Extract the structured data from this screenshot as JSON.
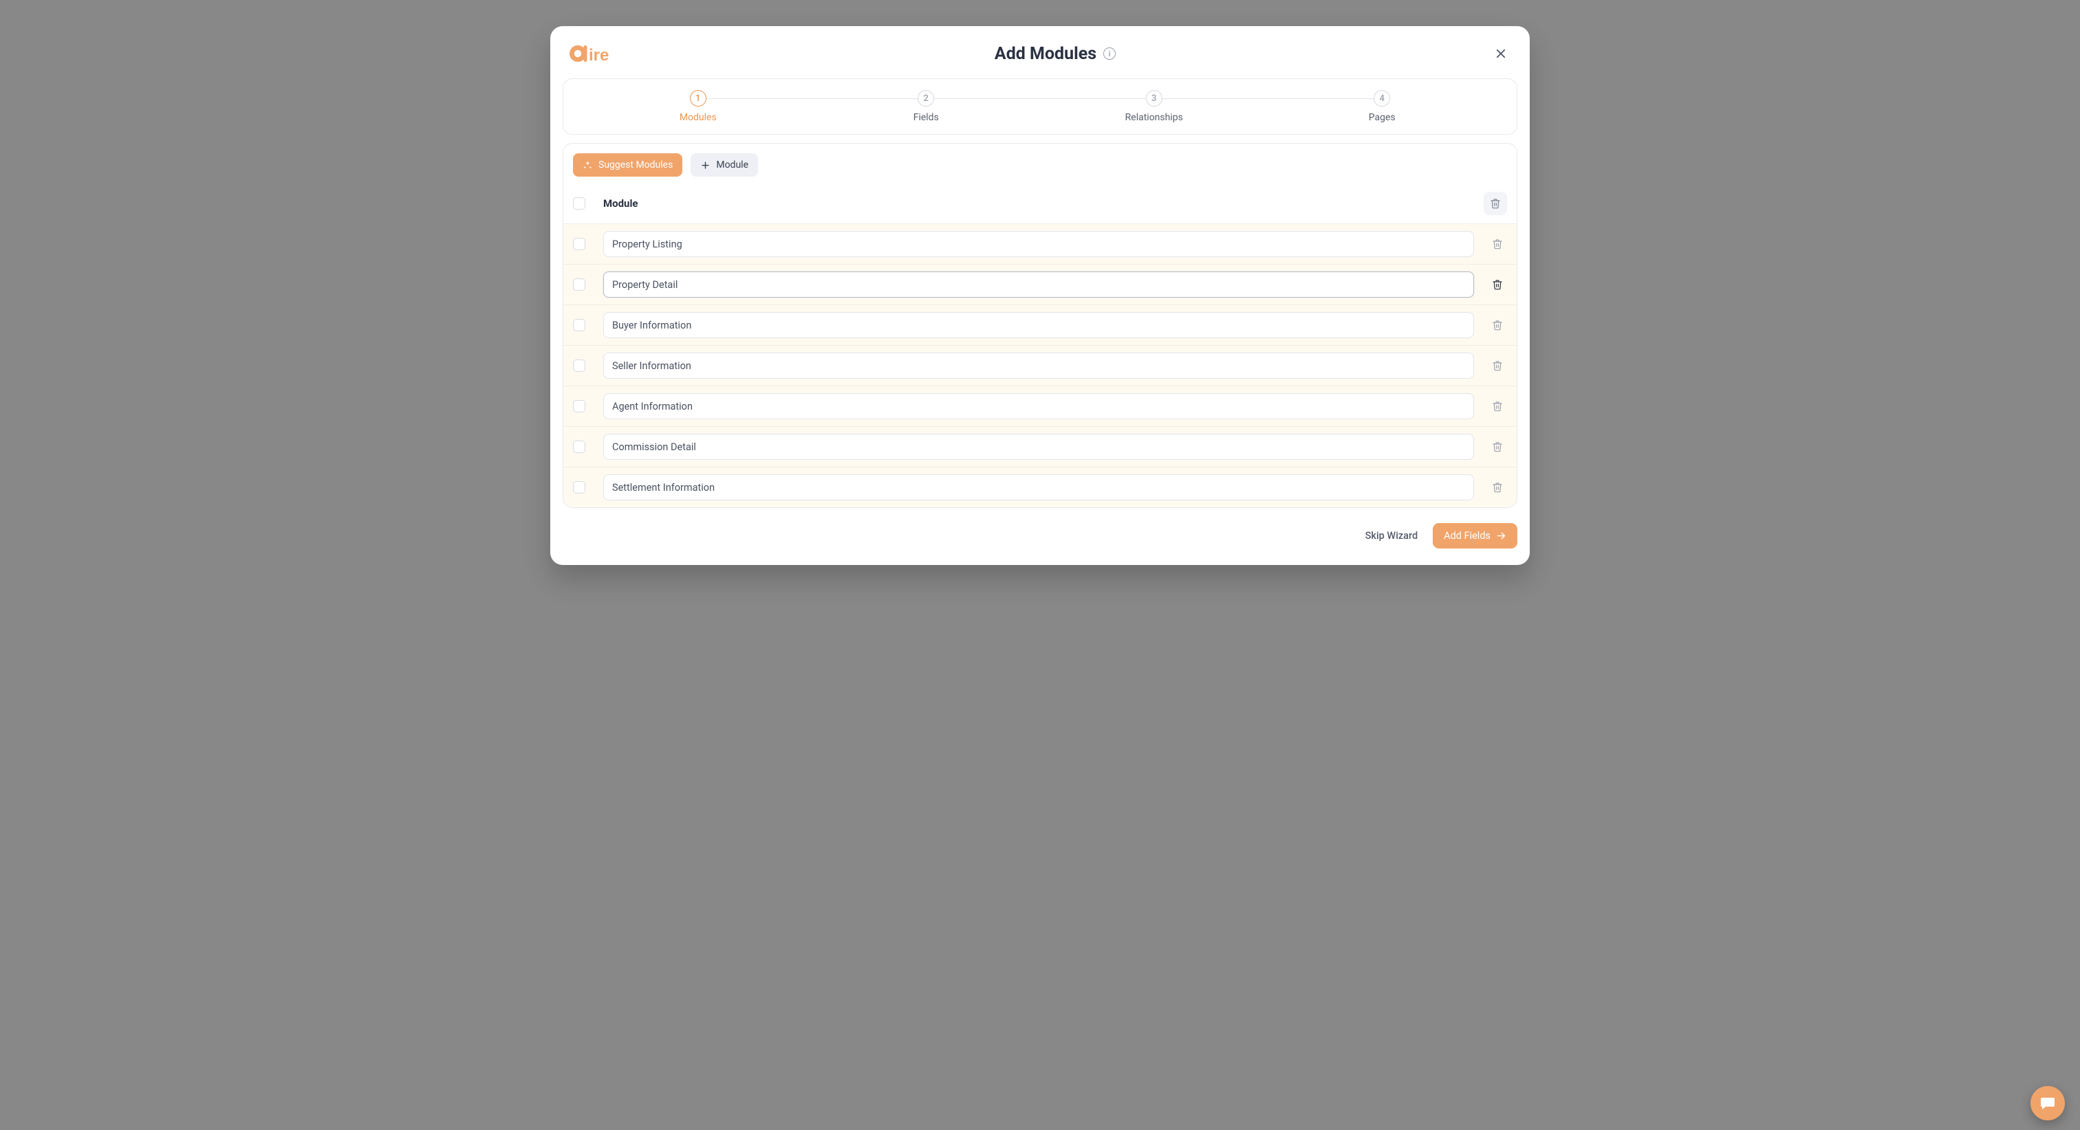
{
  "header": {
    "title": "Add Modules"
  },
  "stepper": {
    "steps": [
      {
        "num": "1",
        "label": "Modules",
        "active": true
      },
      {
        "num": "2",
        "label": "Fields",
        "active": false
      },
      {
        "num": "3",
        "label": "Relationships",
        "active": false
      },
      {
        "num": "4",
        "label": "Pages",
        "active": false
      }
    ]
  },
  "toolbar": {
    "suggest_label": "Suggest Modules",
    "add_module_label": "Module"
  },
  "table": {
    "column_label": "Module",
    "rows": [
      {
        "value": "Property Listing",
        "focused": false
      },
      {
        "value": "Property Detail",
        "focused": true
      },
      {
        "value": "Buyer Information",
        "focused": false
      },
      {
        "value": "Seller Information",
        "focused": false
      },
      {
        "value": "Agent Information",
        "focused": false
      },
      {
        "value": "Commission Detail",
        "focused": false
      },
      {
        "value": "Settlement Information",
        "focused": false
      }
    ]
  },
  "footer": {
    "skip_label": "Skip Wizard",
    "next_label": "Add Fields"
  }
}
